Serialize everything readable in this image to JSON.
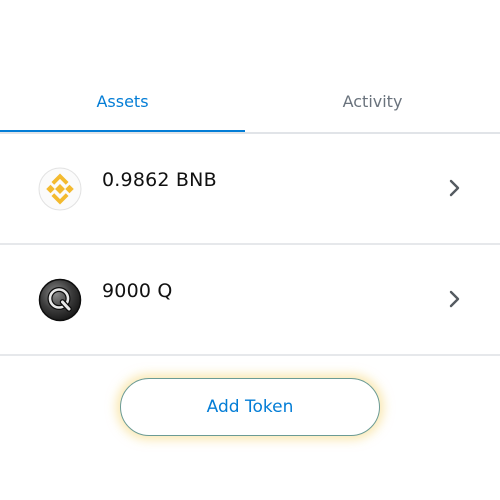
{
  "tabs": [
    {
      "label": "Assets",
      "active": true
    },
    {
      "label": "Activity",
      "active": false
    }
  ],
  "tokens": [
    {
      "balance": "0.9862 BNB",
      "icon": "bnb-icon"
    },
    {
      "balance": "9000 Q",
      "icon": "q-token-icon"
    }
  ],
  "actions": {
    "add_token_label": "Add Token"
  },
  "colors": {
    "accent": "#037dd6",
    "inactive_tab": "#6a737d",
    "bnb_yellow": "#f3ba2f",
    "add_token_glow": "#f6d778"
  }
}
